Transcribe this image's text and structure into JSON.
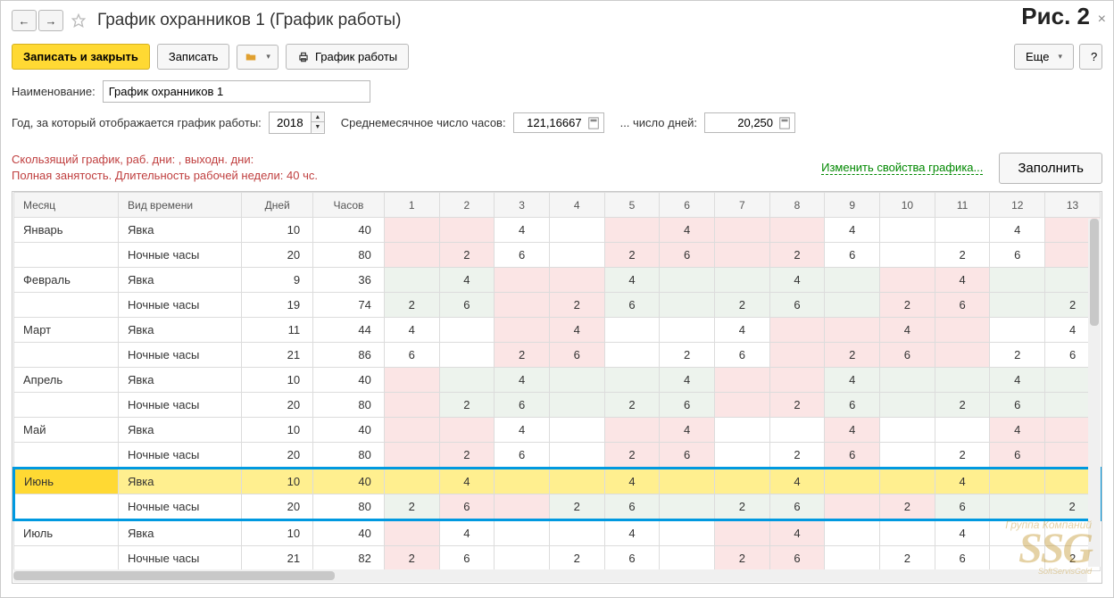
{
  "header": {
    "title": "График охранников 1 (График работы)",
    "figure_label": "Рис. 2"
  },
  "toolbar": {
    "save_close": "Записать и закрыть",
    "save": "Записать",
    "print": "График работы",
    "more": "Еще"
  },
  "fields": {
    "name_label": "Наименование:",
    "name_value": "График охранников 1",
    "year_label": "Год, за который отображается график работы:",
    "year_value": "2018",
    "avg_hours_label": "Среднемесячное число часов:",
    "avg_hours_value": "121,16667",
    "days_label": "... число дней:",
    "days_value": "20,250",
    "info_line1": "Скользящий график, раб. дни: , выходн. дни:",
    "info_line2": "Полная занятость. Длительность рабочей недели: 40 чс.",
    "change_props": "Изменить свойства графика...",
    "fill_btn": "Заполнить"
  },
  "table": {
    "headers": {
      "month": "Месяц",
      "type": "Вид времени",
      "days": "Дней",
      "hours": "Часов"
    },
    "day_cols": [
      "1",
      "2",
      "3",
      "4",
      "5",
      "6",
      "7",
      "8",
      "9",
      "10",
      "11",
      "12",
      "13"
    ],
    "rows": [
      {
        "month": "Январь",
        "type": "Явка",
        "days": "10",
        "hours": "40",
        "cells": [
          {
            "v": "",
            "c": "pink"
          },
          {
            "v": "",
            "c": "pink"
          },
          {
            "v": "4",
            "c": ""
          },
          {
            "v": "",
            "c": ""
          },
          {
            "v": "",
            "c": "pink"
          },
          {
            "v": "4",
            "c": "pink"
          },
          {
            "v": "",
            "c": "pink"
          },
          {
            "v": "",
            "c": "pink"
          },
          {
            "v": "4",
            "c": ""
          },
          {
            "v": "",
            "c": ""
          },
          {
            "v": "",
            "c": ""
          },
          {
            "v": "4",
            "c": ""
          },
          {
            "v": "",
            "c": "pink"
          }
        ]
      },
      {
        "month": "",
        "type": "Ночные часы",
        "days": "20",
        "hours": "80",
        "cells": [
          {
            "v": "",
            "c": "pink"
          },
          {
            "v": "2",
            "c": "pink"
          },
          {
            "v": "6",
            "c": ""
          },
          {
            "v": "",
            "c": ""
          },
          {
            "v": "2",
            "c": "pink"
          },
          {
            "v": "6",
            "c": "pink"
          },
          {
            "v": "",
            "c": "pink"
          },
          {
            "v": "2",
            "c": "pink"
          },
          {
            "v": "6",
            "c": ""
          },
          {
            "v": "",
            "c": ""
          },
          {
            "v": "2",
            "c": ""
          },
          {
            "v": "6",
            "c": ""
          },
          {
            "v": "",
            "c": "pink"
          }
        ]
      },
      {
        "month": "Февраль",
        "type": "Явка",
        "days": "9",
        "hours": "36",
        "cells": [
          {
            "v": "",
            "c": "mint"
          },
          {
            "v": "4",
            "c": "mint"
          },
          {
            "v": "",
            "c": "pink"
          },
          {
            "v": "",
            "c": "pink"
          },
          {
            "v": "4",
            "c": "mint"
          },
          {
            "v": "",
            "c": "mint"
          },
          {
            "v": "",
            "c": "mint"
          },
          {
            "v": "4",
            "c": "mint"
          },
          {
            "v": "",
            "c": "mint"
          },
          {
            "v": "",
            "c": "pink"
          },
          {
            "v": "4",
            "c": "pink"
          },
          {
            "v": "",
            "c": "mint"
          },
          {
            "v": "",
            "c": "mint"
          }
        ]
      },
      {
        "month": "",
        "type": "Ночные часы",
        "days": "19",
        "hours": "74",
        "cells": [
          {
            "v": "2",
            "c": "mint"
          },
          {
            "v": "6",
            "c": "mint"
          },
          {
            "v": "",
            "c": "pink"
          },
          {
            "v": "2",
            "c": "pink"
          },
          {
            "v": "6",
            "c": "mint"
          },
          {
            "v": "",
            "c": "mint"
          },
          {
            "v": "2",
            "c": "mint"
          },
          {
            "v": "6",
            "c": "mint"
          },
          {
            "v": "",
            "c": "mint"
          },
          {
            "v": "2",
            "c": "pink"
          },
          {
            "v": "6",
            "c": "pink"
          },
          {
            "v": "",
            "c": "mint"
          },
          {
            "v": "2",
            "c": "mint"
          }
        ]
      },
      {
        "month": "Март",
        "type": "Явка",
        "days": "11",
        "hours": "44",
        "cells": [
          {
            "v": "4",
            "c": ""
          },
          {
            "v": "",
            "c": ""
          },
          {
            "v": "",
            "c": "pink"
          },
          {
            "v": "4",
            "c": "pink"
          },
          {
            "v": "",
            "c": ""
          },
          {
            "v": "",
            "c": ""
          },
          {
            "v": "4",
            "c": ""
          },
          {
            "v": "",
            "c": "pink"
          },
          {
            "v": "",
            "c": "pink"
          },
          {
            "v": "4",
            "c": "pink"
          },
          {
            "v": "",
            "c": "pink"
          },
          {
            "v": "",
            "c": ""
          },
          {
            "v": "4",
            "c": ""
          }
        ]
      },
      {
        "month": "",
        "type": "Ночные часы",
        "days": "21",
        "hours": "86",
        "cells": [
          {
            "v": "6",
            "c": ""
          },
          {
            "v": "",
            "c": ""
          },
          {
            "v": "2",
            "c": "pink"
          },
          {
            "v": "6",
            "c": "pink"
          },
          {
            "v": "",
            "c": ""
          },
          {
            "v": "2",
            "c": ""
          },
          {
            "v": "6",
            "c": ""
          },
          {
            "v": "",
            "c": "pink"
          },
          {
            "v": "2",
            "c": "pink"
          },
          {
            "v": "6",
            "c": "pink"
          },
          {
            "v": "",
            "c": "pink"
          },
          {
            "v": "2",
            "c": ""
          },
          {
            "v": "6",
            "c": ""
          }
        ]
      },
      {
        "month": "Апрель",
        "type": "Явка",
        "days": "10",
        "hours": "40",
        "cells": [
          {
            "v": "",
            "c": "pink"
          },
          {
            "v": "",
            "c": "mint"
          },
          {
            "v": "4",
            "c": "mint"
          },
          {
            "v": "",
            "c": "mint"
          },
          {
            "v": "",
            "c": "mint"
          },
          {
            "v": "4",
            "c": "mint"
          },
          {
            "v": "",
            "c": "pink"
          },
          {
            "v": "",
            "c": "pink"
          },
          {
            "v": "4",
            "c": "mint"
          },
          {
            "v": "",
            "c": "mint"
          },
          {
            "v": "",
            "c": "mint"
          },
          {
            "v": "4",
            "c": "mint"
          },
          {
            "v": "",
            "c": "mint"
          }
        ]
      },
      {
        "month": "",
        "type": "Ночные часы",
        "days": "20",
        "hours": "80",
        "cells": [
          {
            "v": "",
            "c": "pink"
          },
          {
            "v": "2",
            "c": "mint"
          },
          {
            "v": "6",
            "c": "mint"
          },
          {
            "v": "",
            "c": "mint"
          },
          {
            "v": "2",
            "c": "mint"
          },
          {
            "v": "6",
            "c": "mint"
          },
          {
            "v": "",
            "c": "pink"
          },
          {
            "v": "2",
            "c": "pink"
          },
          {
            "v": "6",
            "c": "mint"
          },
          {
            "v": "",
            "c": "mint"
          },
          {
            "v": "2",
            "c": "mint"
          },
          {
            "v": "6",
            "c": "mint"
          },
          {
            "v": "",
            "c": "mint"
          }
        ]
      },
      {
        "month": "Май",
        "type": "Явка",
        "days": "10",
        "hours": "40",
        "cells": [
          {
            "v": "",
            "c": "pink"
          },
          {
            "v": "",
            "c": "pink"
          },
          {
            "v": "4",
            "c": ""
          },
          {
            "v": "",
            "c": ""
          },
          {
            "v": "",
            "c": "pink"
          },
          {
            "v": "4",
            "c": "pink"
          },
          {
            "v": "",
            "c": ""
          },
          {
            "v": "",
            "c": ""
          },
          {
            "v": "4",
            "c": "pink"
          },
          {
            "v": "",
            "c": ""
          },
          {
            "v": "",
            "c": ""
          },
          {
            "v": "4",
            "c": "pink"
          },
          {
            "v": "",
            "c": "pink"
          }
        ]
      },
      {
        "month": "",
        "type": "Ночные часы",
        "days": "20",
        "hours": "80",
        "cells": [
          {
            "v": "",
            "c": "pink"
          },
          {
            "v": "2",
            "c": "pink"
          },
          {
            "v": "6",
            "c": ""
          },
          {
            "v": "",
            "c": ""
          },
          {
            "v": "2",
            "c": "pink"
          },
          {
            "v": "6",
            "c": "pink"
          },
          {
            "v": "",
            "c": ""
          },
          {
            "v": "2",
            "c": ""
          },
          {
            "v": "6",
            "c": "pink"
          },
          {
            "v": "",
            "c": ""
          },
          {
            "v": "2",
            "c": ""
          },
          {
            "v": "6",
            "c": "pink"
          },
          {
            "v": "",
            "c": "pink"
          }
        ]
      },
      {
        "month": "Июнь",
        "type": "Явка",
        "days": "10",
        "hours": "40",
        "cells": [
          {
            "v": "",
            "c": ""
          },
          {
            "v": "4",
            "c": "pink"
          },
          {
            "v": "",
            "c": "pink"
          },
          {
            "v": "",
            "c": ""
          },
          {
            "v": "4",
            "c": ""
          },
          {
            "v": "",
            "c": ""
          },
          {
            "v": "",
            "c": ""
          },
          {
            "v": "4",
            "c": ""
          },
          {
            "v": "",
            "c": "pink"
          },
          {
            "v": "",
            "c": "pink"
          },
          {
            "v": "4",
            "c": ""
          },
          {
            "v": "",
            "c": ""
          },
          {
            "v": "",
            "c": ""
          }
        ],
        "hl": true,
        "box": "top"
      },
      {
        "month": "",
        "type": "Ночные часы",
        "days": "20",
        "hours": "80",
        "cells": [
          {
            "v": "2",
            "c": "mint"
          },
          {
            "v": "6",
            "c": "pink"
          },
          {
            "v": "",
            "c": "pink"
          },
          {
            "v": "2",
            "c": "mint"
          },
          {
            "v": "6",
            "c": "mint"
          },
          {
            "v": "",
            "c": "mint"
          },
          {
            "v": "2",
            "c": "mint"
          },
          {
            "v": "6",
            "c": "mint"
          },
          {
            "v": "",
            "c": "pink"
          },
          {
            "v": "2",
            "c": "pink"
          },
          {
            "v": "6",
            "c": "mint"
          },
          {
            "v": "",
            "c": "mint"
          },
          {
            "v": "2",
            "c": "mint"
          }
        ],
        "box": "bottom"
      },
      {
        "month": "Июль",
        "type": "Явка",
        "days": "10",
        "hours": "40",
        "cells": [
          {
            "v": "",
            "c": "pink"
          },
          {
            "v": "4",
            "c": ""
          },
          {
            "v": "",
            "c": ""
          },
          {
            "v": "",
            "c": ""
          },
          {
            "v": "4",
            "c": ""
          },
          {
            "v": "",
            "c": ""
          },
          {
            "v": "",
            "c": "pink"
          },
          {
            "v": "4",
            "c": "pink"
          },
          {
            "v": "",
            "c": ""
          },
          {
            "v": "",
            "c": ""
          },
          {
            "v": "4",
            "c": ""
          },
          {
            "v": "",
            "c": ""
          },
          {
            "v": "",
            "c": ""
          }
        ]
      },
      {
        "month": "",
        "type": "Ночные часы",
        "days": "21",
        "hours": "82",
        "cells": [
          {
            "v": "2",
            "c": "pink"
          },
          {
            "v": "6",
            "c": ""
          },
          {
            "v": "",
            "c": ""
          },
          {
            "v": "2",
            "c": ""
          },
          {
            "v": "6",
            "c": ""
          },
          {
            "v": "",
            "c": ""
          },
          {
            "v": "2",
            "c": "pink"
          },
          {
            "v": "6",
            "c": "pink"
          },
          {
            "v": "",
            "c": ""
          },
          {
            "v": "2",
            "c": ""
          },
          {
            "v": "6",
            "c": ""
          },
          {
            "v": "",
            "c": ""
          },
          {
            "v": "2",
            "c": ""
          }
        ]
      }
    ]
  },
  "watermark": {
    "top": "Группа Компаний",
    "big": "SSG",
    "bot": "SoftServisGold"
  }
}
